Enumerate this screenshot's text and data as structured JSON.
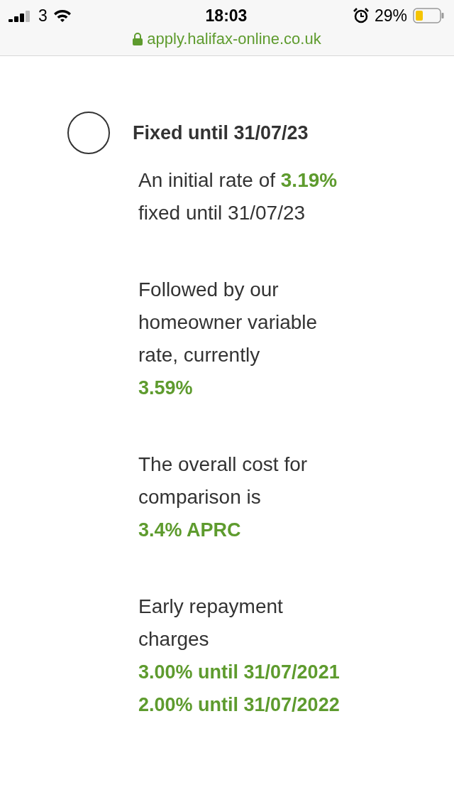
{
  "status_bar": {
    "carrier": "3",
    "time": "18:03",
    "battery": "29%",
    "url": "apply.halifax-online.co.uk"
  },
  "deal": {
    "title": "Fixed until 31/07/23",
    "selected": false,
    "features": [
      {
        "text": "An initial rate of **3.19%** fixed until 31/07/23"
      },
      {
        "text": "Followed by our homeowner variable rate, currently",
        "values": [
          "3.59%"
        ]
      },
      {
        "text": "The overall cost for comparison is",
        "values": [
          "3.4% APRC"
        ]
      },
      {
        "text": "Early repayment charges",
        "values": [
          "3.00% until 31/07/2021",
          "2.00% until 31/07/2022"
        ]
      }
    ]
  }
}
